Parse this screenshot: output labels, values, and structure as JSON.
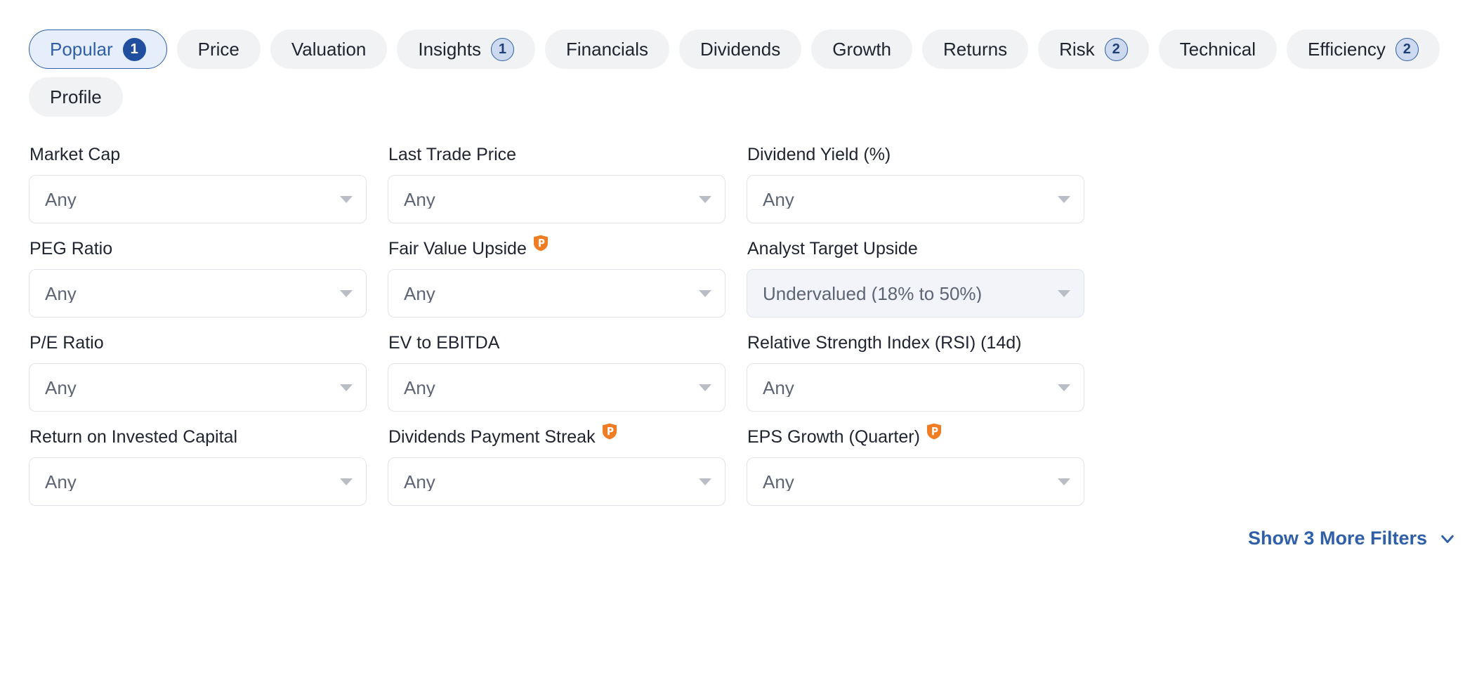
{
  "tabs": [
    {
      "label": "Popular",
      "badge": "1",
      "active": true
    },
    {
      "label": "Price",
      "badge": "",
      "active": false
    },
    {
      "label": "Valuation",
      "badge": "",
      "active": false
    },
    {
      "label": "Insights",
      "badge": "1",
      "active": false
    },
    {
      "label": "Financials",
      "badge": "",
      "active": false
    },
    {
      "label": "Dividends",
      "badge": "",
      "active": false
    },
    {
      "label": "Growth",
      "badge": "",
      "active": false
    },
    {
      "label": "Returns",
      "badge": "",
      "active": false
    },
    {
      "label": "Risk",
      "badge": "2",
      "active": false
    },
    {
      "label": "Technical",
      "badge": "",
      "active": false
    },
    {
      "label": "Efficiency",
      "badge": "2",
      "active": false
    },
    {
      "label": "Profile",
      "badge": "",
      "active": false
    }
  ],
  "filters": [
    {
      "label": "Market Cap",
      "value": "Any",
      "premium": false,
      "selected": false
    },
    {
      "label": "Last Trade Price",
      "value": "Any",
      "premium": false,
      "selected": false
    },
    {
      "label": "Dividend Yield (%)",
      "value": "Any",
      "premium": false,
      "selected": false
    },
    {
      "label": "PEG Ratio",
      "value": "Any",
      "premium": false,
      "selected": false
    },
    {
      "label": "Fair Value Upside",
      "value": "Any",
      "premium": true,
      "selected": false
    },
    {
      "label": "Analyst Target Upside",
      "value": "Undervalued (18% to 50%)",
      "premium": false,
      "selected": true
    },
    {
      "label": "P/E Ratio",
      "value": "Any",
      "premium": false,
      "selected": false
    },
    {
      "label": "EV to EBITDA",
      "value": "Any",
      "premium": false,
      "selected": false
    },
    {
      "label": "Relative Strength Index (RSI) (14d)",
      "value": "Any",
      "premium": false,
      "selected": false
    },
    {
      "label": "Return on Invested Capital",
      "value": "Any",
      "premium": false,
      "selected": false
    },
    {
      "label": "Dividends Payment Streak",
      "value": "Any",
      "premium": true,
      "selected": false
    },
    {
      "label": "EPS Growth (Quarter)",
      "value": "Any",
      "premium": true,
      "selected": false
    }
  ],
  "footer": {
    "more_filters_label": "Show 3 More Filters",
    "chevron_icon": "chevron-down-icon"
  },
  "icons": {
    "premium": "premium-shield-icon",
    "dropdown": "chevron-down-icon"
  },
  "colors": {
    "accent_blue": "#2f5fa8",
    "active_pill_bg": "#e7eefb",
    "pill_bg": "#f1f2f4",
    "badge_active_bg": "#1f4f9e",
    "badge_bg": "#ccd9ee",
    "premium_orange": "#f07d23",
    "selected_field_bg": "#f2f4fa",
    "field_border": "#e2e4e9",
    "value_text": "#5d6575"
  }
}
